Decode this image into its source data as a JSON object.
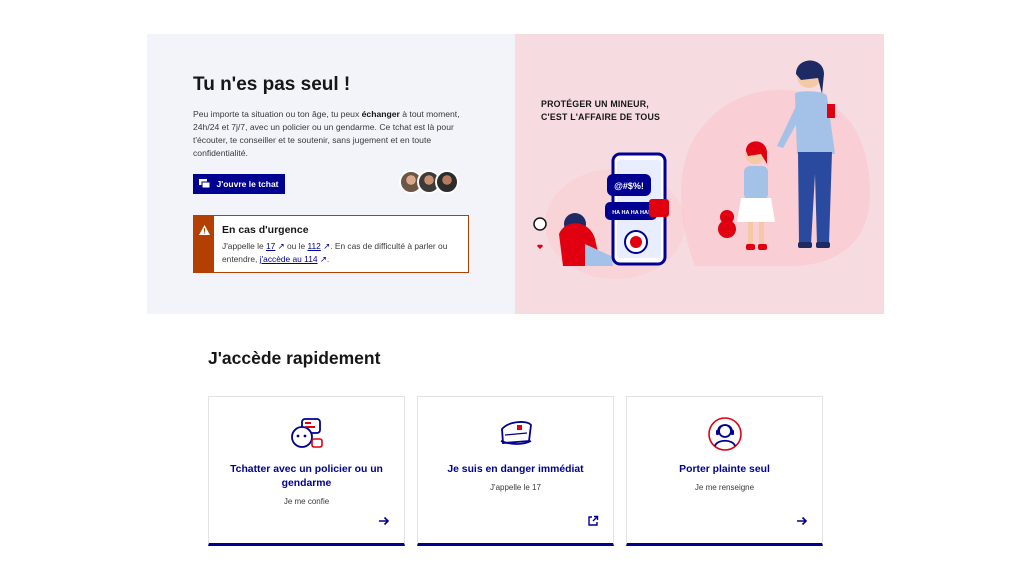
{
  "hero": {
    "title": "Tu n'es pas seul !",
    "description": {
      "part1": "Peu importe ta situation ou ton âge, tu peux ",
      "bold": "échanger",
      "part2": " à tout moment, 24h/24 et 7j/7, avec un policier ou un gendarme. Ce tchat est là pour t'écouter, te conseiller et te soutenir, sans jugement et en toute confidentialité."
    },
    "chat_button": "J'ouvre le tchat",
    "slogan_line1": "PROTÉGER UN MINEUR,",
    "slogan_line2": "C'EST L'AFFAIRE DE TOUS",
    "bubble_text_1": "@#$%!",
    "bubble_text_2": "HA HA HA HA!"
  },
  "urgence": {
    "title": "En cas d'urgence",
    "t1": "J'appelle le ",
    "link17": "17",
    "t2": " ou le ",
    "link112": "112",
    "t3": ". En cas de difficulté à parler ou entendre, ",
    "link114": "j'accède au 114",
    "t4": "."
  },
  "quick": {
    "title": "J'accède rapidement",
    "cards": [
      {
        "title": "Tchatter avec un policier ou un gendarme",
        "subtitle": "Je me confie",
        "icon": "chat-bubbles-icon",
        "arrow": "arrow-right-icon"
      },
      {
        "title": "Je suis en danger immédiat",
        "subtitle": "J'appelle le 17",
        "icon": "police-cap-icon",
        "arrow": "external-link-icon"
      },
      {
        "title": "Porter plainte seul",
        "subtitle": "Je me renseigne",
        "icon": "person-headset-icon",
        "arrow": "arrow-right-icon"
      }
    ]
  },
  "colors": {
    "primary": "#000091",
    "warning": "#b34000",
    "hero_left_bg": "#f3f3fa",
    "hero_right_bg": "#f6dce0"
  }
}
